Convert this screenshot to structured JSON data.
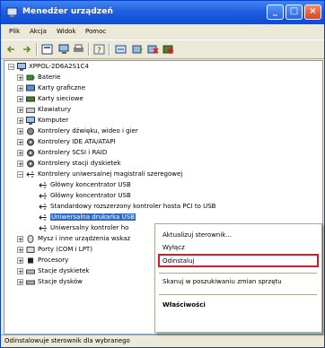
{
  "window": {
    "title": "Menedżer urządzeń"
  },
  "menubar": {
    "items": [
      "Plik",
      "Akcja",
      "Widok",
      "Pomoc"
    ]
  },
  "toolbar": {
    "icons": [
      "back-icon",
      "forward-icon",
      "properties-icon",
      "computer-icon",
      "print-icon",
      "help-icon",
      "scan-icon",
      "update-icon",
      "uninstall-icon",
      "disable-icon"
    ]
  },
  "tree": {
    "root": "XPPOL-2D6A2S1C4",
    "items": [
      {
        "label": "Baterie"
      },
      {
        "label": "Karty graficzne"
      },
      {
        "label": "Karty sieciowe"
      },
      {
        "label": "Klawiatury"
      },
      {
        "label": "Komputer"
      },
      {
        "label": "Kontrolery dźwięku, wideo i gier"
      },
      {
        "label": "Kontrolery IDE ATA/ATAPI"
      },
      {
        "label": "Kontrolery SCSI i RAID"
      },
      {
        "label": "Kontrolery stacji dyskietek"
      },
      {
        "label": "Kontrolery uniwersalnej magistrali szeregowej"
      },
      {
        "label": "Główny koncentrator USB"
      },
      {
        "label": "Główny koncentrator USB"
      },
      {
        "label": "Standardowy rozszerzony kontroler hosta PCI to USB"
      },
      {
        "label": "Uniwersalna drukarka USB"
      },
      {
        "label": "Uniwersalny kontroler ho"
      },
      {
        "label": "Mysz i inne urządzenia wskaz"
      },
      {
        "label": "Porty (COM i LPT)"
      },
      {
        "label": "Procesory"
      },
      {
        "label": "Stacje dyskietek"
      },
      {
        "label": "Stacje dysków"
      }
    ]
  },
  "context_menu": {
    "items": [
      "Aktualizuj sterownik...",
      "Wyłącz",
      "Odinstaluj",
      "Skanuj w poszukiwaniu zmian sprzętu",
      "Właściwości"
    ],
    "highlighted": "Odinstaluj"
  },
  "statusbar": {
    "text": "Odinstalowuje sterownik dla wybranego"
  }
}
